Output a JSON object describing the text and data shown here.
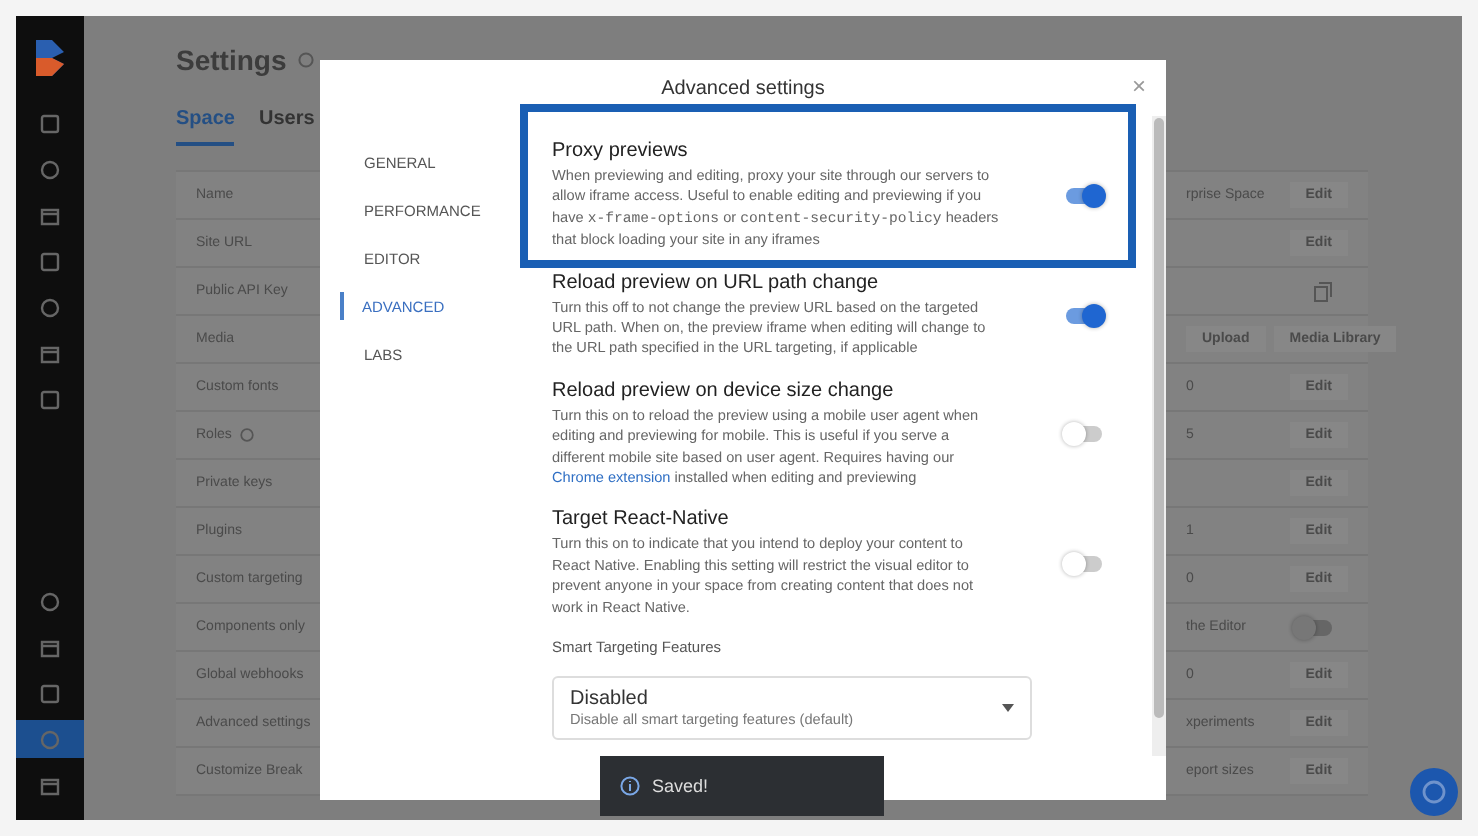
{
  "sidebar": {
    "items": [
      {
        "kind": "top",
        "selected": false
      },
      {
        "kind": "top",
        "selected": false
      },
      {
        "kind": "top",
        "selected": false
      },
      {
        "kind": "top",
        "selected": false
      },
      {
        "kind": "top",
        "selected": false
      },
      {
        "kind": "top",
        "selected": false
      },
      {
        "kind": "top",
        "selected": false
      },
      {
        "kind": "bottom",
        "selected": false
      },
      {
        "kind": "bottom",
        "selected": false
      },
      {
        "kind": "bottom",
        "selected": false
      },
      {
        "kind": "bottom",
        "selected": true
      },
      {
        "kind": "bottom",
        "selected": false
      }
    ]
  },
  "page": {
    "title": "Settings",
    "tabs": [
      {
        "label": "Space",
        "selected": true
      },
      {
        "label": "Users",
        "selected": false
      }
    ],
    "rows": [
      {
        "name": "Name",
        "value": "rprise Space",
        "actions": [
          "Edit"
        ]
      },
      {
        "name": "Site URL",
        "actions": [
          "Edit"
        ]
      },
      {
        "name": "Public API Key",
        "kind": "copy"
      },
      {
        "name": "Media",
        "actions": [
          "Upload",
          "Media Library"
        ]
      },
      {
        "name": "Custom fonts",
        "value": "0",
        "actions": [
          "Edit"
        ]
      },
      {
        "name": "Roles",
        "help": true,
        "value": "5",
        "actions": [
          "Edit"
        ]
      },
      {
        "name": "Private keys",
        "actions": [
          "Edit"
        ]
      },
      {
        "name": "Plugins",
        "value": "1",
        "actions": [
          "Edit"
        ]
      },
      {
        "name": "Custom targeting",
        "value": "0",
        "actions": [
          "Edit"
        ]
      },
      {
        "name": "Components only",
        "value": "the Editor",
        "kind": "toggle",
        "on": false
      },
      {
        "name": "Global webhooks",
        "value": "0",
        "actions": [
          "Edit"
        ]
      },
      {
        "name": "Advanced settings",
        "value": "xperiments",
        "actions": [
          "Edit"
        ]
      },
      {
        "name": "Customize Break",
        "value": "eport sizes",
        "actions": [
          "Edit"
        ]
      }
    ]
  },
  "modal": {
    "title": "Advanced settings",
    "close": "×",
    "nav": [
      {
        "label": "GENERAL",
        "selected": false
      },
      {
        "label": "PERFORMANCE",
        "selected": false
      },
      {
        "label": "EDITOR",
        "selected": false
      },
      {
        "label": "ADVANCED",
        "selected": true
      },
      {
        "label": "LABS",
        "selected": false
      }
    ],
    "settings": [
      {
        "title": "Proxy previews",
        "on": true,
        "highlighted": true,
        "description": [
          {
            "kind": "text",
            "text": "When previewing and editing, proxy your site through our servers to allow iframe access. Useful to enable editing and previewing if you have "
          },
          {
            "kind": "code",
            "text": "x-frame-options"
          },
          {
            "kind": "text",
            "text": " or "
          },
          {
            "kind": "code",
            "text": "content-security-policy"
          },
          {
            "kind": "text",
            "text": " headers that block loading your site in any iframes"
          }
        ]
      },
      {
        "title": "Reload preview on URL path change",
        "on": true,
        "highlighted": false,
        "description": [
          {
            "kind": "text",
            "text": "Turn this off to not change the preview URL based on the targeted URL path. When on, the preview iframe when editing will change to the URL path specified in the URL targeting, if applicable"
          }
        ]
      },
      {
        "title": "Reload preview on device size change",
        "on": false,
        "highlighted": false,
        "description": [
          {
            "kind": "text",
            "text": "Turn this on to reload the preview using a mobile user agent when editing and previewing for mobile. This is useful if you serve a different mobile site based on user agent. Requires having our "
          },
          {
            "kind": "link",
            "text": "Chrome extension"
          },
          {
            "kind": "text",
            "text": " installed when editing and previewing"
          }
        ]
      },
      {
        "title": "Target React-Native",
        "on": false,
        "highlighted": false,
        "description": [
          {
            "kind": "text",
            "text": "Turn this on to indicate that you intend to deploy your content to React Native. Enabling this setting will restrict the visual editor to prevent anyone in your space from creating content that does not work in React Native."
          }
        ]
      }
    ],
    "select": {
      "label": "Smart Targeting Features",
      "value": "Disabled",
      "description": "Disable all smart targeting features (default)"
    }
  },
  "toast": {
    "message": "Saved!"
  }
}
